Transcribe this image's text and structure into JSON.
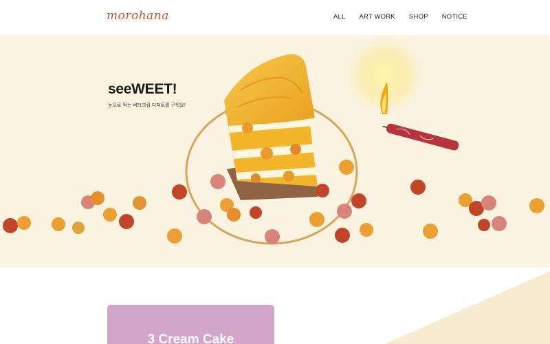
{
  "brand": {
    "logo_text": "morohana"
  },
  "nav": {
    "items": [
      "ALL",
      "ART WORK",
      "SHOP",
      "NOTICE"
    ]
  },
  "hero": {
    "title": "seeWEET!",
    "subtitle": "눈으로 먹는 버터크림 디저트를 구워요!"
  },
  "featured": {
    "card_title": "3 Cream Cake"
  },
  "colors": {
    "hero_bg": "#faf3e0",
    "logo": "#c0562e",
    "card_bg": "#d3a5c9",
    "cake_yellow": "#f3b62a",
    "candle_red": "#b8333c",
    "accent_corner": "#f7ecd0"
  }
}
